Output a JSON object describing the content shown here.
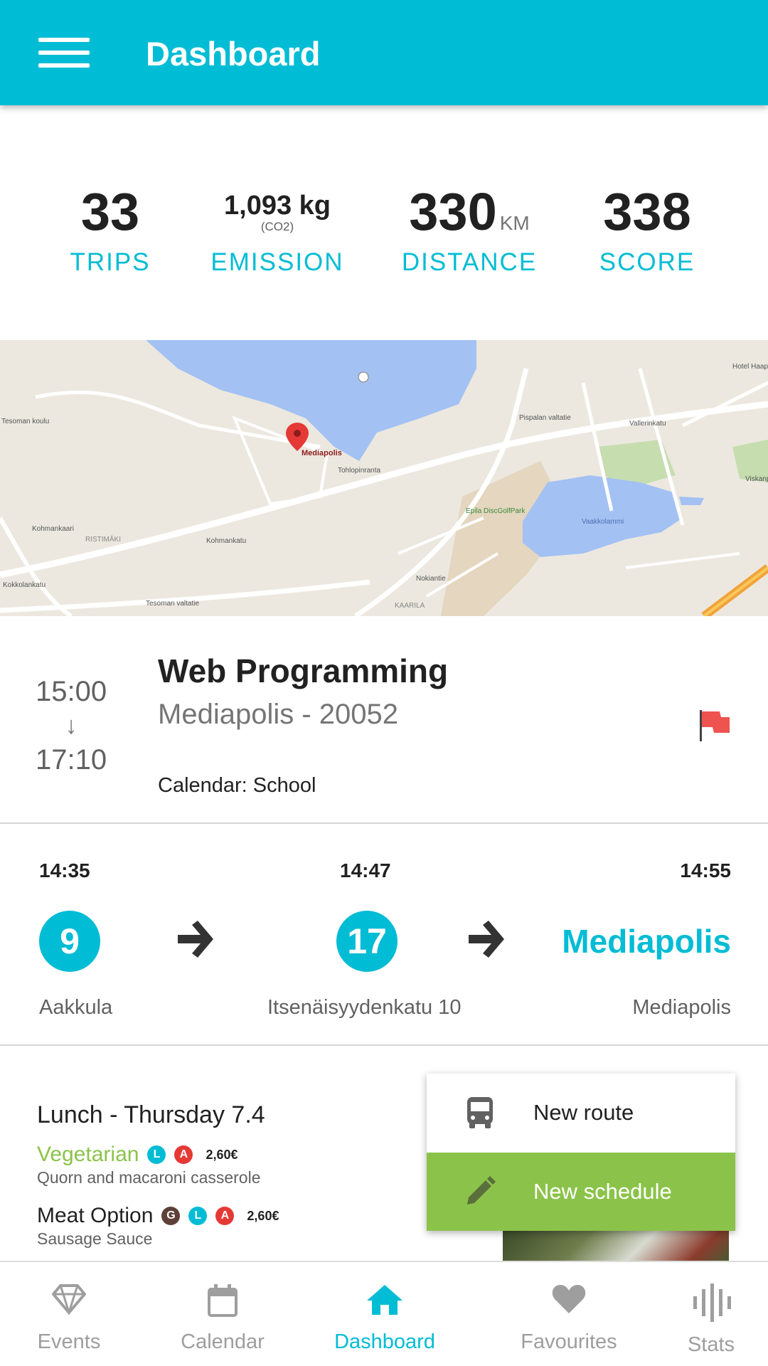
{
  "appbar": {
    "title": "Dashboard",
    "color": "#00BCD4"
  },
  "stats": {
    "trips": {
      "value": "33",
      "label": "TRIPS"
    },
    "emission": {
      "value": "1,093 kg",
      "sub": "(CO2)",
      "label": "EMISSION"
    },
    "distance": {
      "value": "330",
      "unit": "KM",
      "label": "DISTANCE"
    },
    "score": {
      "value": "338",
      "label": "SCORE"
    }
  },
  "map": {
    "pin_label": "Mediapolis",
    "place_labels": [
      "Tesoman koulu",
      "Pispalan valtatie",
      "Tohlopinranta",
      "Epila DiscGolfPark",
      "Vaakkolammi",
      "RISTIMÄKI",
      "Kohmankatu",
      "Tesoman valtatie",
      "KAARILA",
      "Hotel Haap",
      "Vallerinkatu",
      "Viskanp",
      "Nokiantie",
      "Kohmankaari",
      "Kokkolankatu"
    ]
  },
  "event": {
    "start": "15:00",
    "arrow": "↓",
    "end": "17:10",
    "title": "Web Programming",
    "location": "Mediapolis - 20052",
    "calendar": "Calendar: School"
  },
  "route": {
    "times": [
      "14:35",
      "14:47",
      "14:55"
    ],
    "legs": [
      {
        "line": "9",
        "stop": "Aakkula"
      },
      {
        "line": "17",
        "stop": "Itsenäisyydenkatu 10"
      }
    ],
    "destination": {
      "name": "Mediapolis",
      "stop": "Mediapolis"
    }
  },
  "lunch": {
    "title": "Lunch - Thursday 7.4",
    "meals": [
      {
        "name": "Vegetarian",
        "badges": [
          "L",
          "A"
        ],
        "price": "2,60€",
        "desc": "Quorn and macaroni casserole"
      },
      {
        "name": "Meat Option",
        "badges": [
          "G",
          "L",
          "A"
        ],
        "price": "2,60€",
        "desc": "Sausage Sauce"
      }
    ]
  },
  "popup": {
    "items": [
      {
        "label": "New route",
        "icon": "bus-icon"
      },
      {
        "label": "New schedule",
        "icon": "pencil-icon"
      }
    ],
    "active_color": "#8BC34A"
  },
  "bottomnav": {
    "items": [
      {
        "label": "Events",
        "icon": "diamond-icon"
      },
      {
        "label": "Calendar",
        "icon": "calendar-icon"
      },
      {
        "label": "Dashboard",
        "icon": "home-icon",
        "active": true
      },
      {
        "label": "Favourites",
        "icon": "heart-icon"
      },
      {
        "label": "Stats",
        "icon": "equalizer-icon"
      }
    ]
  }
}
